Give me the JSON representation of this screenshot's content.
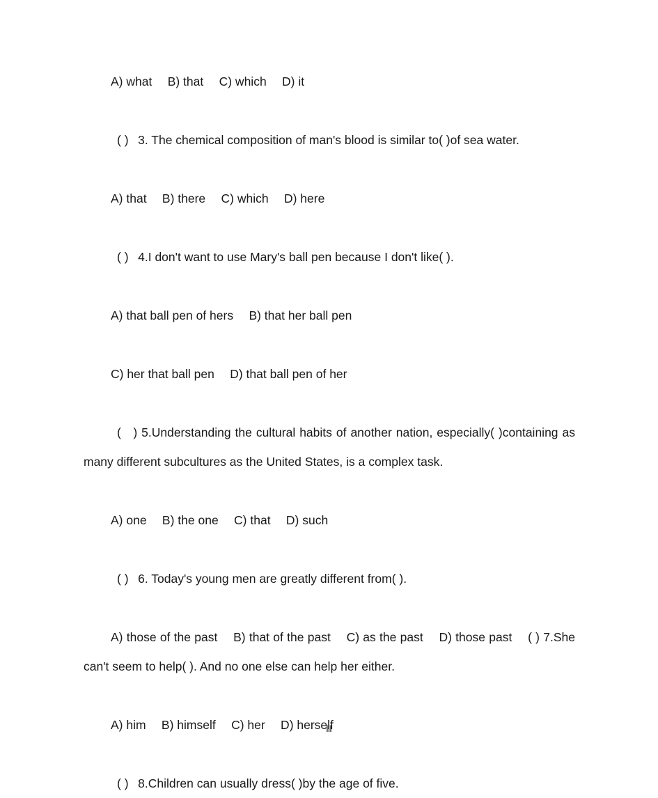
{
  "document": {
    "type": "grammar-multiple-choice-worksheet",
    "page_number": "Ⅲ",
    "text_color": "#1a1a1a",
    "background_color": "#ffffff"
  },
  "blocks": [
    {
      "id": "q2-options",
      "kind": "options",
      "text": "A) what  B) that  C) which  D) it"
    },
    {
      "id": "q3-stem",
      "kind": "question",
      "text": "( )  3. The chemical composition of man's blood is similar to( )of sea water."
    },
    {
      "id": "q3-options",
      "kind": "options",
      "text": "A) that  B) there  C) which  D) here"
    },
    {
      "id": "q4-stem",
      "kind": "question",
      "text": "( )  4.I don't want to use Mary's ball pen because I don't like( )."
    },
    {
      "id": "q4-options-ab",
      "kind": "options",
      "text": "A) that ball pen of hers  B) that her ball pen"
    },
    {
      "id": "q4-options-cd",
      "kind": "options",
      "text": "C) her that ball pen  D) that ball pen of her"
    },
    {
      "id": "q5-stem",
      "kind": "paragraph",
      "text": "( ) 5.Understanding the cultural habits of another nation, especially( )containing as many different subcultures as the United States, is a complex task."
    },
    {
      "id": "q5-options",
      "kind": "options",
      "text": "A) one  B) the one  C) that  D) such"
    },
    {
      "id": "q6-stem",
      "kind": "question",
      "text": "( )  6. Today's young men are greatly different from( )."
    },
    {
      "id": "q6-options-and-q7-stem",
      "kind": "paragraph-noindent",
      "text": "A) those of the past  B) that of the past  C) as the past  D) those past  ( ) 7.She can't seem to help( ). And no one else can help her either."
    },
    {
      "id": "q7-options",
      "kind": "options",
      "text": "A) him  B) himself  C) her  D) herself"
    },
    {
      "id": "q8-stem",
      "kind": "question",
      "text": "( )  8.Children can usually dress( )by the age of five."
    }
  ],
  "questions": [
    {
      "number": "3",
      "stem": "The chemical composition of man's blood is similar to( )of sea water.",
      "options": [
        "A) that",
        "B) there",
        "C) which",
        "D) here"
      ]
    },
    {
      "number": "4",
      "stem": "I don't want to use Mary's ball pen because I don't like( ).",
      "options": [
        "A) that ball pen of hers",
        "B) that her ball pen",
        "C) her that ball pen",
        "D) that ball pen of her"
      ]
    },
    {
      "number": "5",
      "stem": "Understanding the cultural habits of another nation, especially( )containing as many different subcultures as the United States, is a complex task.",
      "options": [
        "A) one",
        "B) the one",
        "C) that",
        "D) such"
      ]
    },
    {
      "number": "6",
      "stem": "Today's young men are greatly different from( ).",
      "options": [
        "A) those of the past",
        "B) that of the past",
        "C) as the past",
        "D) those past"
      ]
    },
    {
      "number": "7",
      "stem": "She can't seem to help( ). And no one else can help her either.",
      "options": [
        "A) him",
        "B) himself",
        "C) her",
        "D) herself"
      ]
    },
    {
      "number": "8",
      "stem": "Children can usually dress( )by the age of five.",
      "options": []
    }
  ],
  "footer": {
    "page_label": "Ⅲ"
  }
}
